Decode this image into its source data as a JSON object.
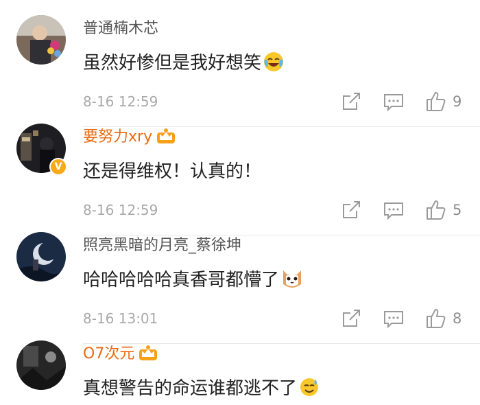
{
  "comments": [
    {
      "username": "普通楠木芯",
      "text": "虽然好惨但是我好想笑",
      "emoji": "laughing-crying-emoji",
      "time": "8-16 12:59",
      "likes": "9",
      "vip": false,
      "verified": false
    },
    {
      "username": "要努力xry",
      "text": "还是得维权！认真的！",
      "emoji": "",
      "time": "8-16 12:59",
      "likes": "5",
      "vip": true,
      "verified": true
    },
    {
      "username": "照亮黑暗的月亮_蔡徐坤",
      "text": "哈哈哈哈哈真香哥都懵了",
      "emoji": "cat-face-emoji",
      "time": "8-16 13:01",
      "likes": "8",
      "vip": false,
      "verified": false
    },
    {
      "username": "O7次元",
      "text": "真想警告的命运谁都逃不了",
      "emoji": "sweat-smile-emoji",
      "time": "",
      "likes": "",
      "vip": true,
      "verified": false
    }
  ],
  "colors": {
    "vip_name": "#ea6b10",
    "name": "#555555",
    "meta": "#a9a9a9",
    "badge": "#f7a91a"
  },
  "icons": {
    "share": "share-icon",
    "reply": "comment-icon",
    "like": "thumbs-up-icon",
    "vip": "vip-crown-icon",
    "verified": "verified-v-icon"
  }
}
